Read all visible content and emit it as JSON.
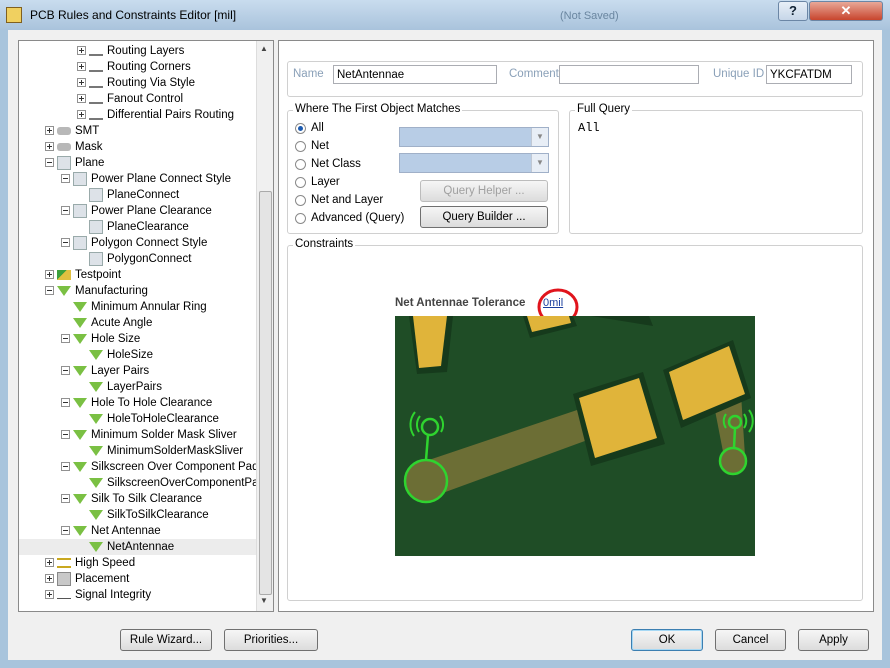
{
  "window": {
    "title": "PCB Rules and Constraints Editor [mil]",
    "ghost_title": "(Not Saved)",
    "help_label": "?",
    "close_label": "✕"
  },
  "tree": [
    {
      "level": 3,
      "expander": "plus",
      "icon": "route",
      "label": "Routing Layers"
    },
    {
      "level": 3,
      "expander": "plus",
      "icon": "route",
      "label": "Routing Corners"
    },
    {
      "level": 3,
      "expander": "plus",
      "icon": "route",
      "label": "Routing Via Style"
    },
    {
      "level": 3,
      "expander": "plus",
      "icon": "route",
      "label": "Fanout Control"
    },
    {
      "level": 3,
      "expander": "plus",
      "icon": "route",
      "label": "Differential Pairs Routing"
    },
    {
      "level": 1,
      "expander": "plus",
      "icon": "gray",
      "label": "SMT"
    },
    {
      "level": 1,
      "expander": "plus",
      "icon": "gray",
      "label": "Mask"
    },
    {
      "level": 1,
      "expander": "minus",
      "icon": "plane",
      "label": "Plane"
    },
    {
      "level": 2,
      "expander": "minus",
      "icon": "plane",
      "label": "Power Plane Connect Style"
    },
    {
      "level": 3,
      "expander": "none",
      "icon": "plane",
      "label": "PlaneConnect"
    },
    {
      "level": 2,
      "expander": "minus",
      "icon": "plane",
      "label": "Power Plane Clearance"
    },
    {
      "level": 3,
      "expander": "none",
      "icon": "plane",
      "label": "PlaneClearance"
    },
    {
      "level": 2,
      "expander": "minus",
      "icon": "plane",
      "label": "Polygon Connect Style"
    },
    {
      "level": 3,
      "expander": "none",
      "icon": "plane",
      "label": "PolygonConnect"
    },
    {
      "level": 1,
      "expander": "plus",
      "icon": "test",
      "label": "Testpoint"
    },
    {
      "level": 1,
      "expander": "minus",
      "icon": "tri",
      "label": "Manufacturing"
    },
    {
      "level": 2,
      "expander": "none",
      "icon": "tri",
      "label": "Minimum Annular Ring"
    },
    {
      "level": 2,
      "expander": "none",
      "icon": "tri",
      "label": "Acute Angle"
    },
    {
      "level": 2,
      "expander": "minus",
      "icon": "tri",
      "label": "Hole Size"
    },
    {
      "level": 3,
      "expander": "none",
      "icon": "tri",
      "label": "HoleSize"
    },
    {
      "level": 2,
      "expander": "minus",
      "icon": "tri",
      "label": "Layer Pairs"
    },
    {
      "level": 3,
      "expander": "none",
      "icon": "tri",
      "label": "LayerPairs"
    },
    {
      "level": 2,
      "expander": "minus",
      "icon": "tri",
      "label": "Hole To Hole Clearance"
    },
    {
      "level": 3,
      "expander": "none",
      "icon": "tri",
      "label": "HoleToHoleClearance"
    },
    {
      "level": 2,
      "expander": "minus",
      "icon": "tri",
      "label": "Minimum Solder Mask Sliver"
    },
    {
      "level": 3,
      "expander": "none",
      "icon": "tri",
      "label": "MinimumSolderMaskSliver"
    },
    {
      "level": 2,
      "expander": "minus",
      "icon": "tri",
      "label": "Silkscreen Over Component Pads"
    },
    {
      "level": 3,
      "expander": "none",
      "icon": "tri",
      "label": "SilkscreenOverComponentPac"
    },
    {
      "level": 2,
      "expander": "minus",
      "icon": "tri",
      "label": "Silk To Silk Clearance"
    },
    {
      "level": 3,
      "expander": "none",
      "icon": "tri",
      "label": "SilkToSilkClearance"
    },
    {
      "level": 2,
      "expander": "minus",
      "icon": "tri",
      "label": "Net Antennae"
    },
    {
      "level": 3,
      "expander": "none",
      "icon": "tri",
      "label": "NetAntennae",
      "selected": true
    },
    {
      "level": 1,
      "expander": "plus",
      "icon": "hs",
      "label": "High Speed"
    },
    {
      "level": 1,
      "expander": "plus",
      "icon": "place",
      "label": "Placement"
    },
    {
      "level": 1,
      "expander": "plus",
      "icon": "sig",
      "label": "Signal Integrity"
    }
  ],
  "rule": {
    "name_label": "Name",
    "name_value": "NetAntennae",
    "comment_label": "Comment",
    "comment_value": "",
    "uid_label": "Unique ID",
    "uid_value": "YKCFATDM"
  },
  "match": {
    "title": "Where The First Object Matches",
    "options": [
      "All",
      "Net",
      "Net Class",
      "Layer",
      "Net and Layer",
      "Advanced (Query)"
    ],
    "selected": "All",
    "query_helper": "Query Helper ...",
    "query_builder": "Query Builder ..."
  },
  "full_query": {
    "title": "Full Query",
    "text": "All"
  },
  "constraints": {
    "title": "Constraints",
    "tolerance_label": "Net Antennae Tolerance",
    "tolerance_value": "0mil"
  },
  "buttons": {
    "rule_wizard": "Rule Wizard...",
    "priorities": "Priorities...",
    "ok": "OK",
    "cancel": "Cancel",
    "apply": "Apply"
  },
  "colors": {
    "board": "#1f4d26",
    "pad": "#e0b43a",
    "highlight": "#2fd42f",
    "annotation_circle": "#e0141c"
  }
}
